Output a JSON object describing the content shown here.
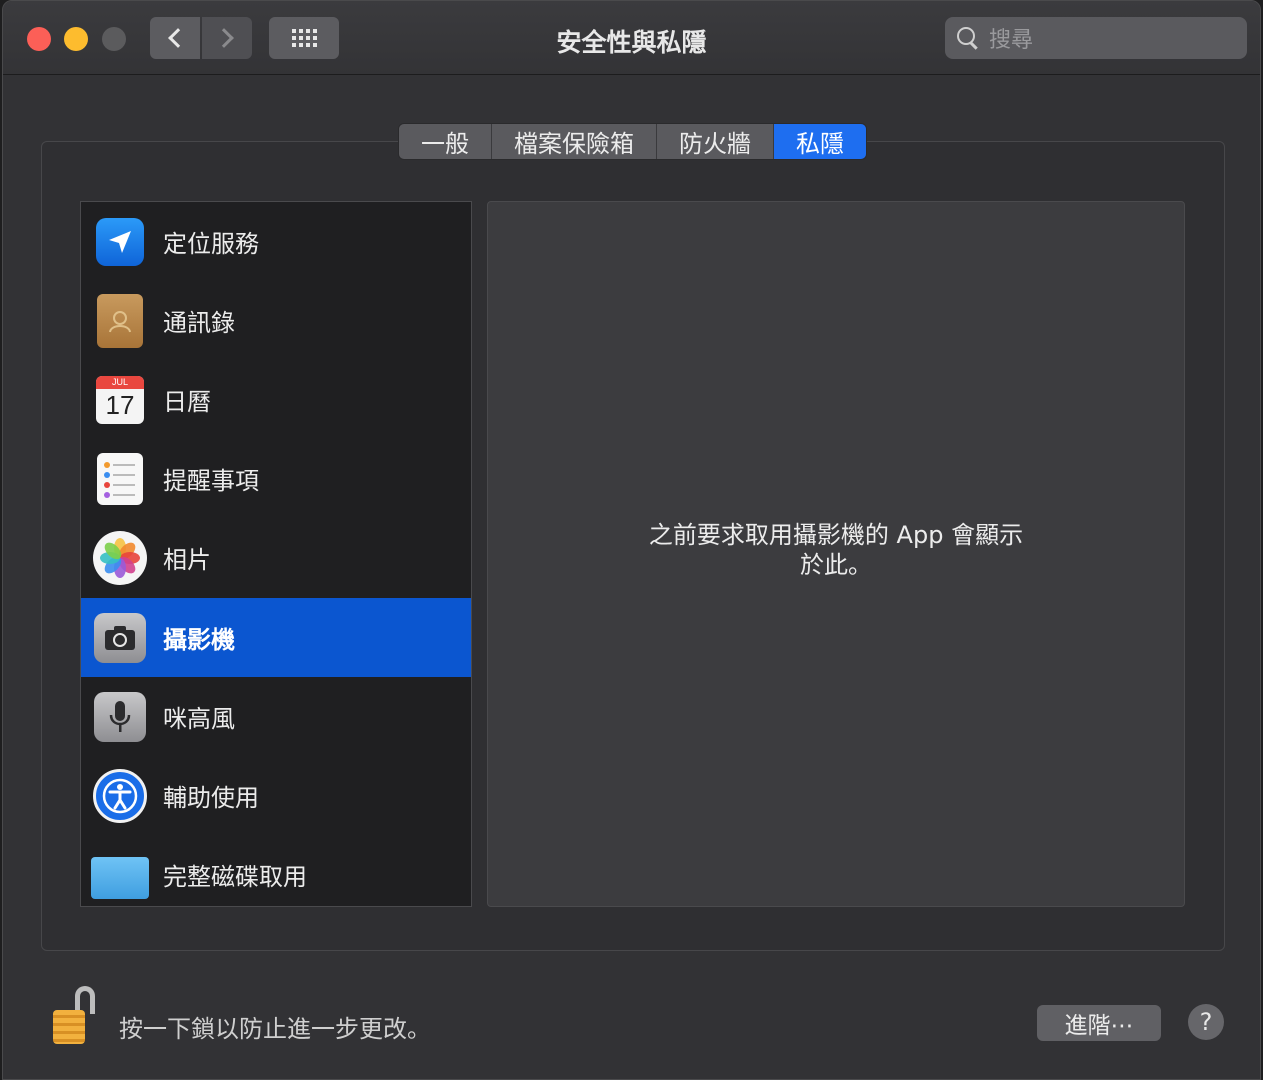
{
  "window": {
    "title": "安全性與私隱",
    "search_placeholder": "搜尋"
  },
  "tabs": [
    {
      "label": "一般",
      "active": false
    },
    {
      "label": "檔案保險箱",
      "active": false
    },
    {
      "label": "防火牆",
      "active": false
    },
    {
      "label": "私隱",
      "active": true
    }
  ],
  "privacy_list": [
    {
      "label": "定位服務",
      "icon": "location-arrow-icon"
    },
    {
      "label": "通訊錄",
      "icon": "contacts-book-icon"
    },
    {
      "label": "日曆",
      "icon": "calendar-icon",
      "month": "JUL",
      "day": "17"
    },
    {
      "label": "提醒事項",
      "icon": "reminders-icon"
    },
    {
      "label": "相片",
      "icon": "photos-icon"
    },
    {
      "label": "攝影機",
      "icon": "camera-icon",
      "selected": true
    },
    {
      "label": "咪高風",
      "icon": "microphone-icon"
    },
    {
      "label": "輔助使用",
      "icon": "accessibility-icon"
    },
    {
      "label": "完整磁碟取用",
      "icon": "folder-icon"
    }
  ],
  "detail": {
    "message_line1": "之前要求取用攝影機的 App 會顯示",
    "message_line2": "於此。"
  },
  "footer": {
    "lock_text": "按一下鎖以防止進一步更改。",
    "advanced_label": "進階⋯",
    "help_label": "?"
  },
  "colors": {
    "accent": "#1e6ef0",
    "selection": "#0b56d0",
    "window_bg": "#323235"
  }
}
